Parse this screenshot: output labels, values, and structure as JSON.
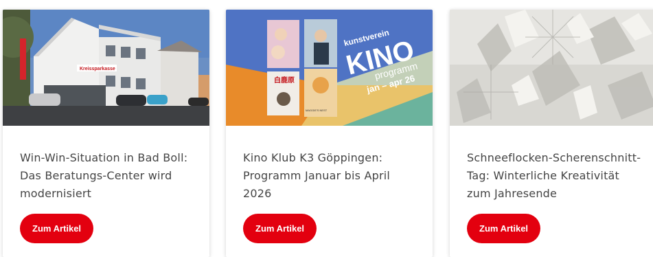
{
  "cards": [
    {
      "title": "Win-Win-Situation in Bad Boll: Das Beratungs-Center wird modernisiert",
      "button_label": "Zum Artikel",
      "image_sign": "Kreissparkasse"
    },
    {
      "title": "Kino Klub K3 Göppingen: Programm Januar bis April 2026",
      "button_label": "Zum Artikel",
      "image_text": {
        "line1": "kunstverein",
        "line2": "KINO",
        "line3": "programm",
        "line4": "jan – apr 26",
        "poster_title": "白鹿原",
        "poster_label": "MAGGIE'S NEST"
      }
    },
    {
      "title": "Schneeflocken-Scherenschnitt-Tag: Winterliche Kreativität zum Jahresende",
      "button_label": "Zum Artikel"
    }
  ],
  "colors": {
    "brand_red": "#e3000f",
    "title_text": "#444444"
  }
}
